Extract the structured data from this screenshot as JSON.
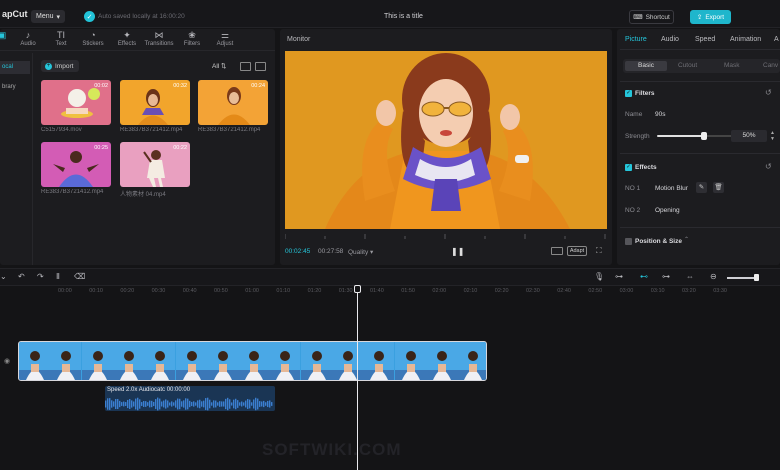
{
  "titlebar": {
    "logo": "apCut",
    "menu_label": "Menu",
    "save_status": "Auto saved locally at 16:00:20",
    "project_title": "This is a title",
    "shortcut_label": "Shortcut",
    "export_label": "Export"
  },
  "media": {
    "tools": [
      {
        "label": "Audio",
        "icon": "music-note-icon"
      },
      {
        "label": "Text",
        "icon": "text-icon"
      },
      {
        "label": "Stickers",
        "icon": "sticker-icon"
      },
      {
        "label": "Effects",
        "icon": "sparkle-icon"
      },
      {
        "label": "Transitions",
        "icon": "transition-icon"
      },
      {
        "label": "Filters",
        "icon": "filters-icon"
      },
      {
        "label": "Adjust",
        "icon": "sliders-icon"
      }
    ],
    "side": [
      "ocal",
      "brary"
    ],
    "import_label": "Import",
    "filter_all": "All",
    "thumbnails": [
      {
        "label": "C5157934.mov",
        "duration": "00:02",
        "bg": "#e0708a"
      },
      {
        "label": "RE3837B3721412.mp4",
        "duration": "00:32",
        "bg": "#f2a52c"
      },
      {
        "label": "RE3837B3721412.mp4",
        "duration": "00:24",
        "bg": "#f3a336"
      },
      {
        "label": "RE3837B3721412.mp4",
        "duration": "00:25",
        "bg": "#d35cb5"
      },
      {
        "label": "人物素材 04.mp4",
        "duration": "00:22",
        "bg": "#e9a0c0"
      }
    ]
  },
  "monitor": {
    "title": "Monitor",
    "current_time": "00:02:45",
    "total_time": "00:27:58",
    "quality": "Quality",
    "adapt_label": "Adapt"
  },
  "props": {
    "tabs": [
      "Picture",
      "Audio",
      "Speed",
      "Animation",
      "A"
    ],
    "subtabs": [
      "Basic",
      "Cutout",
      "Mask",
      "Canv"
    ],
    "filters": {
      "title": "Filters",
      "name_label": "Name",
      "name_value": "90s",
      "strength_label": "Strength",
      "strength_value": "50%",
      "strength_fraction": 0.5
    },
    "effects": {
      "title": "Effects",
      "rows": [
        {
          "label": "NO 1",
          "value": "Motion Blur"
        },
        {
          "label": "NO 2",
          "value": "Opening"
        }
      ]
    },
    "position_title": "Position & Size"
  },
  "timeline": {
    "ruler": [
      "00:00",
      "00:10",
      "00:20",
      "00:30",
      "00:40",
      "00:50",
      "01:00",
      "01:10",
      "01:20",
      "01:30",
      "01:40",
      "01:50",
      "02:00",
      "02:10",
      "02:20",
      "02:30",
      "02:40",
      "02:50",
      "03:00",
      "03:10",
      "03:20",
      "03:30"
    ],
    "audio_label": "Speed 2.0x   Audiocatc   00:00:00"
  },
  "colors": {
    "accent": "#25c6db",
    "export": "#1fb6cc",
    "video_bg": "#e09820",
    "clip_sky": "#3aa0e0"
  }
}
